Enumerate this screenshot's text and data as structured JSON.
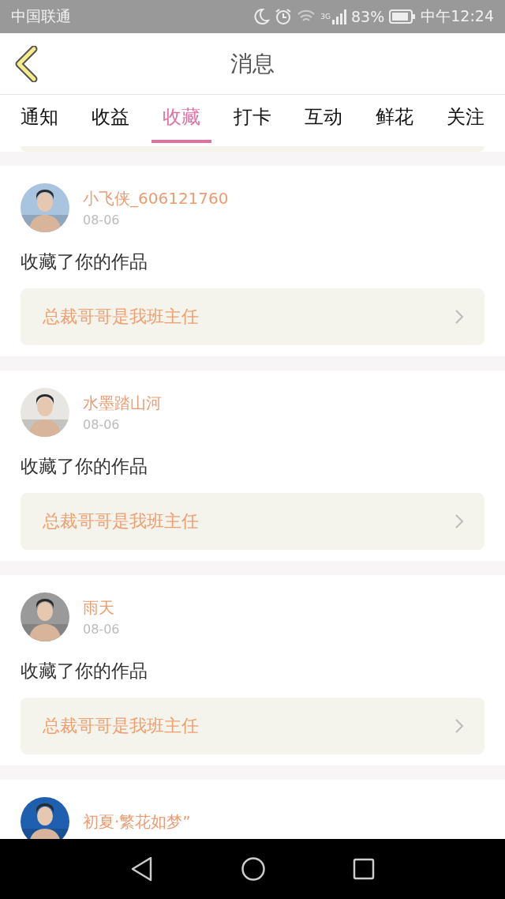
{
  "status_bar": {
    "carrier": "中国联通",
    "network": "3G",
    "battery": "83%",
    "time": "中午12:24"
  },
  "header": {
    "title": "消息"
  },
  "tabs": [
    {
      "label": "通知",
      "selected": false
    },
    {
      "label": "收益",
      "selected": false
    },
    {
      "label": "收藏",
      "selected": true
    },
    {
      "label": "打卡",
      "selected": false
    },
    {
      "label": "互动",
      "selected": false
    },
    {
      "label": "鲜花",
      "selected": false
    },
    {
      "label": "关注",
      "selected": false
    }
  ],
  "messages": [
    {
      "user": "小飞侠_606121760",
      "date": "08-06",
      "action": "收藏了你的作品",
      "work": "总裁哥哥是我班主任"
    },
    {
      "user": "水墨踏山河",
      "date": "08-06",
      "action": "收藏了你的作品",
      "work": "总裁哥哥是我班主任"
    },
    {
      "user": "雨天",
      "date": "08-06",
      "action": "收藏了你的作品",
      "work": "总裁哥哥是我班主任"
    },
    {
      "user": "初夏·繁花如梦”"
    }
  ]
}
